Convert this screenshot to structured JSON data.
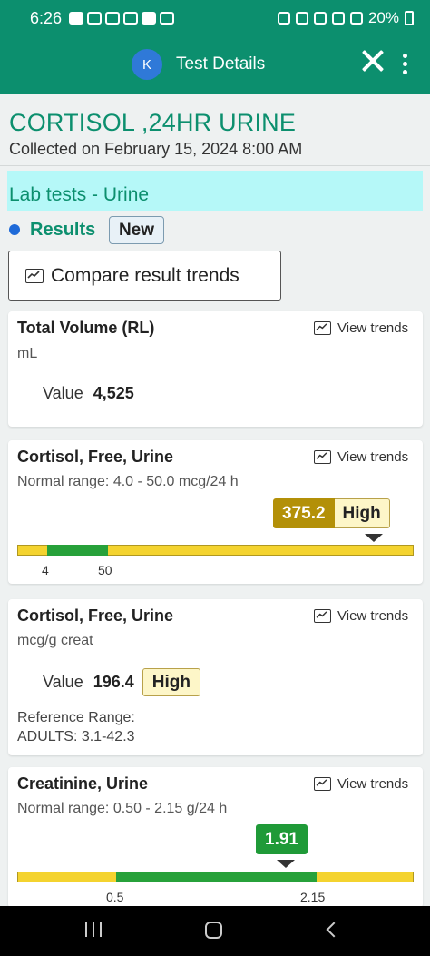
{
  "status": {
    "time": "6:26",
    "battery": "20%",
    "icons": [
      "youtube-icon",
      "instagram-icon",
      "photos-icon",
      "instagram-icon",
      "s-icon",
      "gmail-icon",
      "nfc-icon",
      "alarm-icon",
      "mute-icon",
      "wifi-icon",
      "signal-icon",
      "battery-icon"
    ]
  },
  "header": {
    "avatar_letter": "K",
    "title": "Test Details",
    "close_icon": "close-icon",
    "menu_icon": "more-vert-icon"
  },
  "test": {
    "name": "CORTISOL ,24HR URINE",
    "collected": "Collected on February 15, 2024 8:00 AM"
  },
  "section": {
    "title": "Lab tests - Urine",
    "results_label": "Results",
    "new_badge": "New",
    "compare_label": "Compare result trends"
  },
  "view_trends_label": "View trends",
  "value_label": "Value",
  "cards": [
    {
      "name": "Total Volume (RL)",
      "unit": "mL",
      "value": "4,525"
    },
    {
      "name": "Cortisol, Free, Urine",
      "range": "Normal range: 4.0 - 50.0 mcg/24 h",
      "value": "375.2",
      "flag": "High",
      "tick_low": "4",
      "tick_high": "50",
      "value_color": "#b39008"
    },
    {
      "name": "Cortisol, Free, Urine",
      "unit": "mcg/g creat",
      "value": "196.4",
      "flag": "High",
      "ref_label": "Reference Range:",
      "ref_value": "ADULTS: 3.1-42.3"
    },
    {
      "name": "Creatinine, Urine",
      "range": "Normal range: 0.50 - 2.15 g/24 h",
      "value": "1.91",
      "tick_low": "0.5",
      "tick_high": "2.15",
      "value_color": "#1f9a38"
    }
  ],
  "nav": {
    "recent_icon": "recent-apps-icon",
    "home_icon": "home-icon",
    "back_icon": "back-icon"
  }
}
